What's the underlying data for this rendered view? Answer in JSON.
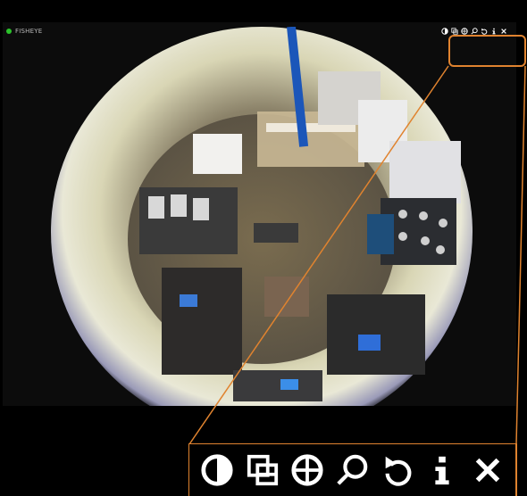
{
  "camera": {
    "name": "FISHEYE",
    "status_color": "#2bc22b"
  },
  "toolbar": {
    "items": [
      {
        "name": "contrast",
        "icon": "contrast-icon"
      },
      {
        "name": "windows",
        "icon": "windows-icon"
      },
      {
        "name": "globe",
        "icon": "globe-icon"
      },
      {
        "name": "search",
        "icon": "search-icon"
      },
      {
        "name": "refresh",
        "icon": "refresh-icon"
      },
      {
        "name": "info",
        "icon": "info-icon"
      },
      {
        "name": "close",
        "icon": "close-icon"
      }
    ]
  },
  "colors": {
    "callout": "#e0832f",
    "icon": "#ffffff"
  }
}
